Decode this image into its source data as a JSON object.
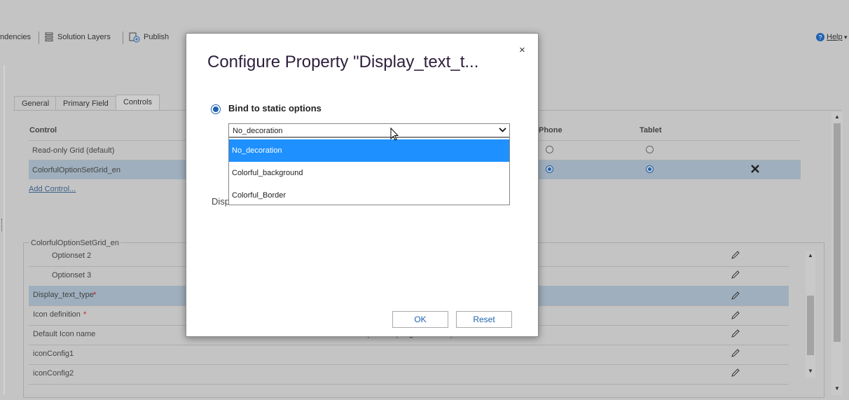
{
  "toolbar": {
    "dependencies_label": "ndencies",
    "solution_layers_label": "Solution Layers",
    "publish_label": "Publish",
    "help_label": "Help"
  },
  "tabs": [
    {
      "label": "General"
    },
    {
      "label": "Primary Field"
    },
    {
      "label": "Controls"
    }
  ],
  "controls_grid": {
    "headers": {
      "control": "Control",
      "phone": "Phone",
      "tablet": "Tablet"
    },
    "rows": [
      {
        "name": "Read-only Grid (default)",
        "phone": false,
        "tablet": false
      },
      {
        "name": "ColorfulOptionSetGrid_en",
        "phone": true,
        "tablet": true
      }
    ],
    "add_control_label": "Add Control..."
  },
  "properties": {
    "legend": "ColorfulOptionSetGrid_en",
    "rows": [
      {
        "name": "Optionset 2",
        "required": false,
        "value": ""
      },
      {
        "name": "Optionset 3",
        "required": false,
        "value": ""
      },
      {
        "name": "Display_text_type",
        "required": true,
        "value": ""
      },
      {
        "name": "Icon definition",
        "required": true,
        "value": ""
      },
      {
        "name": "Default Icon name",
        "required": false,
        "value": "CircleShapeSolid (SingleLine.Text)"
      },
      {
        "name": "iconConfig1",
        "required": false,
        "value": ""
      },
      {
        "name": "iconConfig2",
        "required": false,
        "value": ""
      }
    ],
    "required_marker": "*"
  },
  "dialog": {
    "title": "Configure Property \"Display_text_t...",
    "close_glyph": "×",
    "bind_label": "Bind to static options",
    "selected_value": "No_decoration",
    "options": [
      "No_decoration",
      "Colorful_background",
      "Colorful_Border"
    ],
    "display_label_partial": "Disp",
    "ok_label": "OK",
    "reset_label": "Reset"
  },
  "colors": {
    "accent": "#1f62b0",
    "option_highlight": "#1e90ff",
    "selected_row": "#9fafbd",
    "title_color": "#2d1f3c"
  }
}
